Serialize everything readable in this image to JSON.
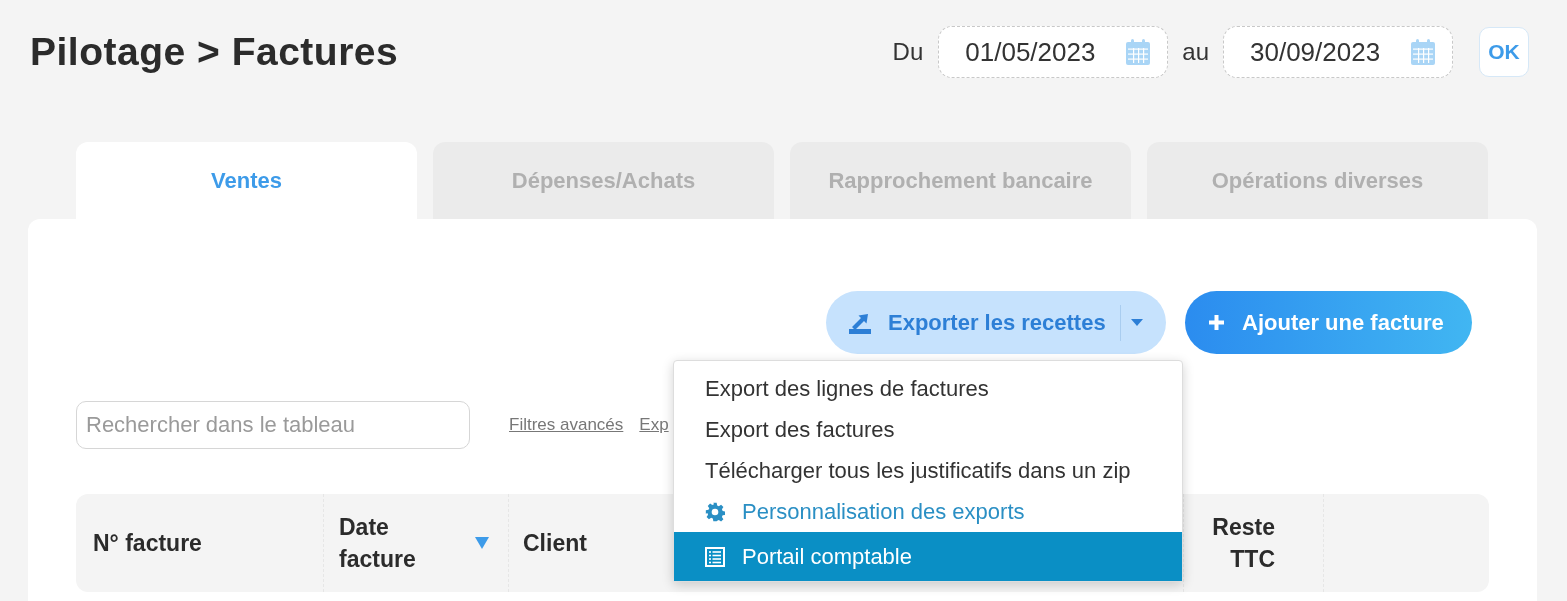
{
  "header": {
    "title": "Pilotage > Factures",
    "date_from": {
      "label": "Du",
      "value": "01/05/2023"
    },
    "date_to": {
      "label": "au",
      "value": "30/09/2023"
    },
    "ok_button": "OK"
  },
  "tabs": [
    {
      "label": "Ventes",
      "selected": true
    },
    {
      "label": "Dépenses/Achats",
      "selected": false
    },
    {
      "label": "Rapprochement bancaire",
      "selected": false
    },
    {
      "label": "Opérations diverses",
      "selected": false
    }
  ],
  "toolbar": {
    "export_button": {
      "label": "Exporter les recettes",
      "expanded": true,
      "menu": [
        {
          "label": "Export des lignes de factures",
          "kind": "plain",
          "selected": false
        },
        {
          "label": "Export des factures",
          "kind": "plain",
          "selected": false
        },
        {
          "label": "Télécharger tous les justificatifs dans un zip",
          "kind": "plain",
          "selected": false
        },
        {
          "label": "Personnalisation des exports",
          "kind": "setting",
          "selected": false
        },
        {
          "label": "Portail comptable",
          "kind": "portal",
          "selected": true
        }
      ]
    },
    "add_button": "Ajouter une facture"
  },
  "search": {
    "placeholder": "Rechercher dans le tableau"
  },
  "links": [
    "Filtres avancés",
    "Exp"
  ],
  "table": {
    "columns": [
      {
        "label": "N° facture",
        "sorted": false
      },
      {
        "label": "Date facture",
        "sorted": true
      },
      {
        "label": "Client",
        "sorted": false
      },
      {
        "label": "Reste TTC",
        "sorted": false
      }
    ]
  }
}
